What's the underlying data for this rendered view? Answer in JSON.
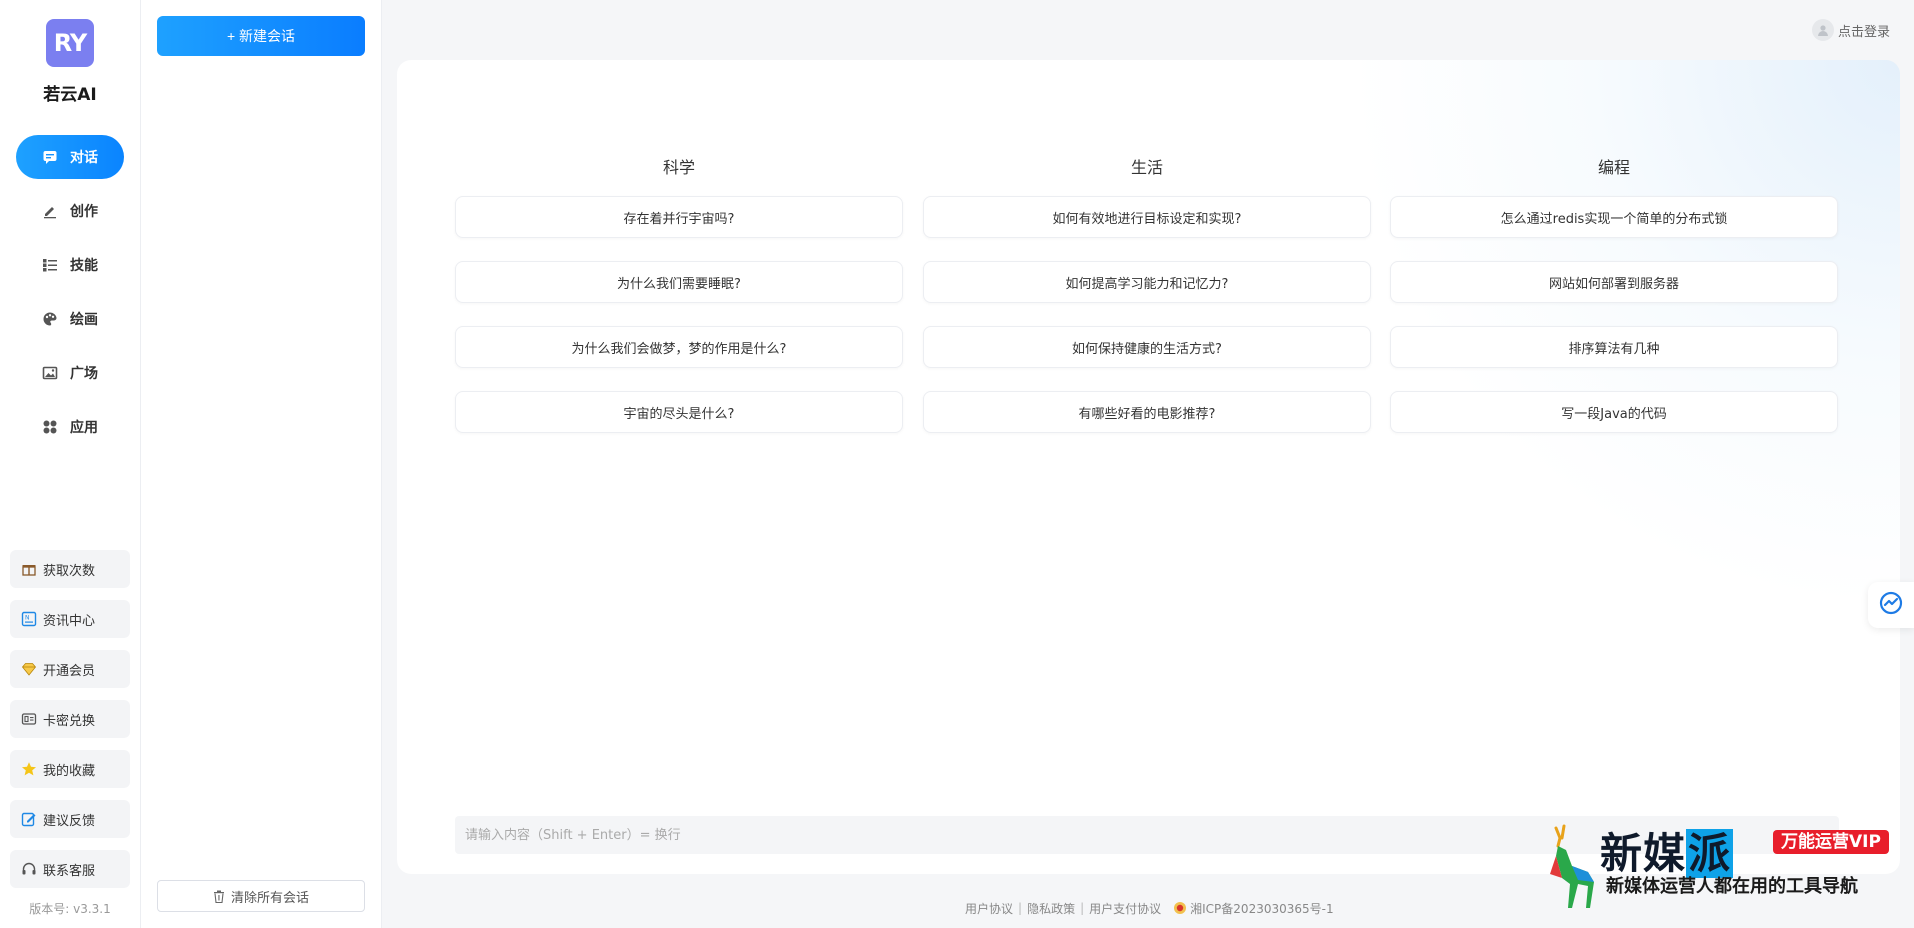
{
  "app": {
    "logo_text": "RY",
    "name": "若云AI",
    "accent_color": "#0a84ff",
    "version": "版本号: v3.3.1"
  },
  "nav": [
    {
      "label": "对话",
      "icon": "chat-icon",
      "active": true
    },
    {
      "label": "创作",
      "icon": "pen-icon",
      "active": false
    },
    {
      "label": "技能",
      "icon": "list-icon",
      "active": false
    },
    {
      "label": "绘画",
      "icon": "palette-icon",
      "active": false
    },
    {
      "label": "广场",
      "icon": "image-icon",
      "active": false
    },
    {
      "label": "应用",
      "icon": "apps-icon",
      "active": false
    }
  ],
  "utilities": [
    {
      "label": "获取次数",
      "icon": "gift-icon"
    },
    {
      "label": "资讯中心",
      "icon": "news-icon"
    },
    {
      "label": "开通会员",
      "icon": "diamond-icon"
    },
    {
      "label": "卡密兑换",
      "icon": "card-icon"
    },
    {
      "label": "我的收藏",
      "icon": "star-icon"
    },
    {
      "label": "建议反馈",
      "icon": "edit-icon"
    },
    {
      "label": "联系客服",
      "icon": "headset-icon"
    }
  ],
  "sessions": {
    "new_chat_label": "+ 新建会话",
    "clear_all_label": "清除所有会话"
  },
  "header": {
    "login_label": "点击登录"
  },
  "suggestions": {
    "columns": [
      {
        "title": "科学",
        "questions": [
          "存在着并行宇宙吗?",
          "为什么我们需要睡眠?",
          "为什么我们会做梦，梦的作用是什么?",
          "宇宙的尽头是什么?"
        ]
      },
      {
        "title": "生活",
        "questions": [
          "如何有效地进行目标设定和实现?",
          "如何提高学习能力和记忆力?",
          "如何保持健康的生活方式?",
          "有哪些好看的电影推荐?"
        ]
      },
      {
        "title": "编程",
        "questions": [
          "怎么通过redis实现一个简单的分布式锁",
          "网站如何部署到服务器",
          "排序算法有几种",
          "写一段Java的代码"
        ]
      }
    ]
  },
  "input": {
    "value": "",
    "placeholder": "请输入内容（Shift + Enter）= 换行"
  },
  "footer": {
    "links": [
      "用户协议",
      "隐私政策",
      "用户支付协议"
    ],
    "icp": "湘ICP备2023030365号-1"
  },
  "watermark": {
    "title_a": "新媒",
    "title_b": "派",
    "badge": "万能运营VIP",
    "subtitle": "新媒体运营人都在用的工具导航"
  }
}
